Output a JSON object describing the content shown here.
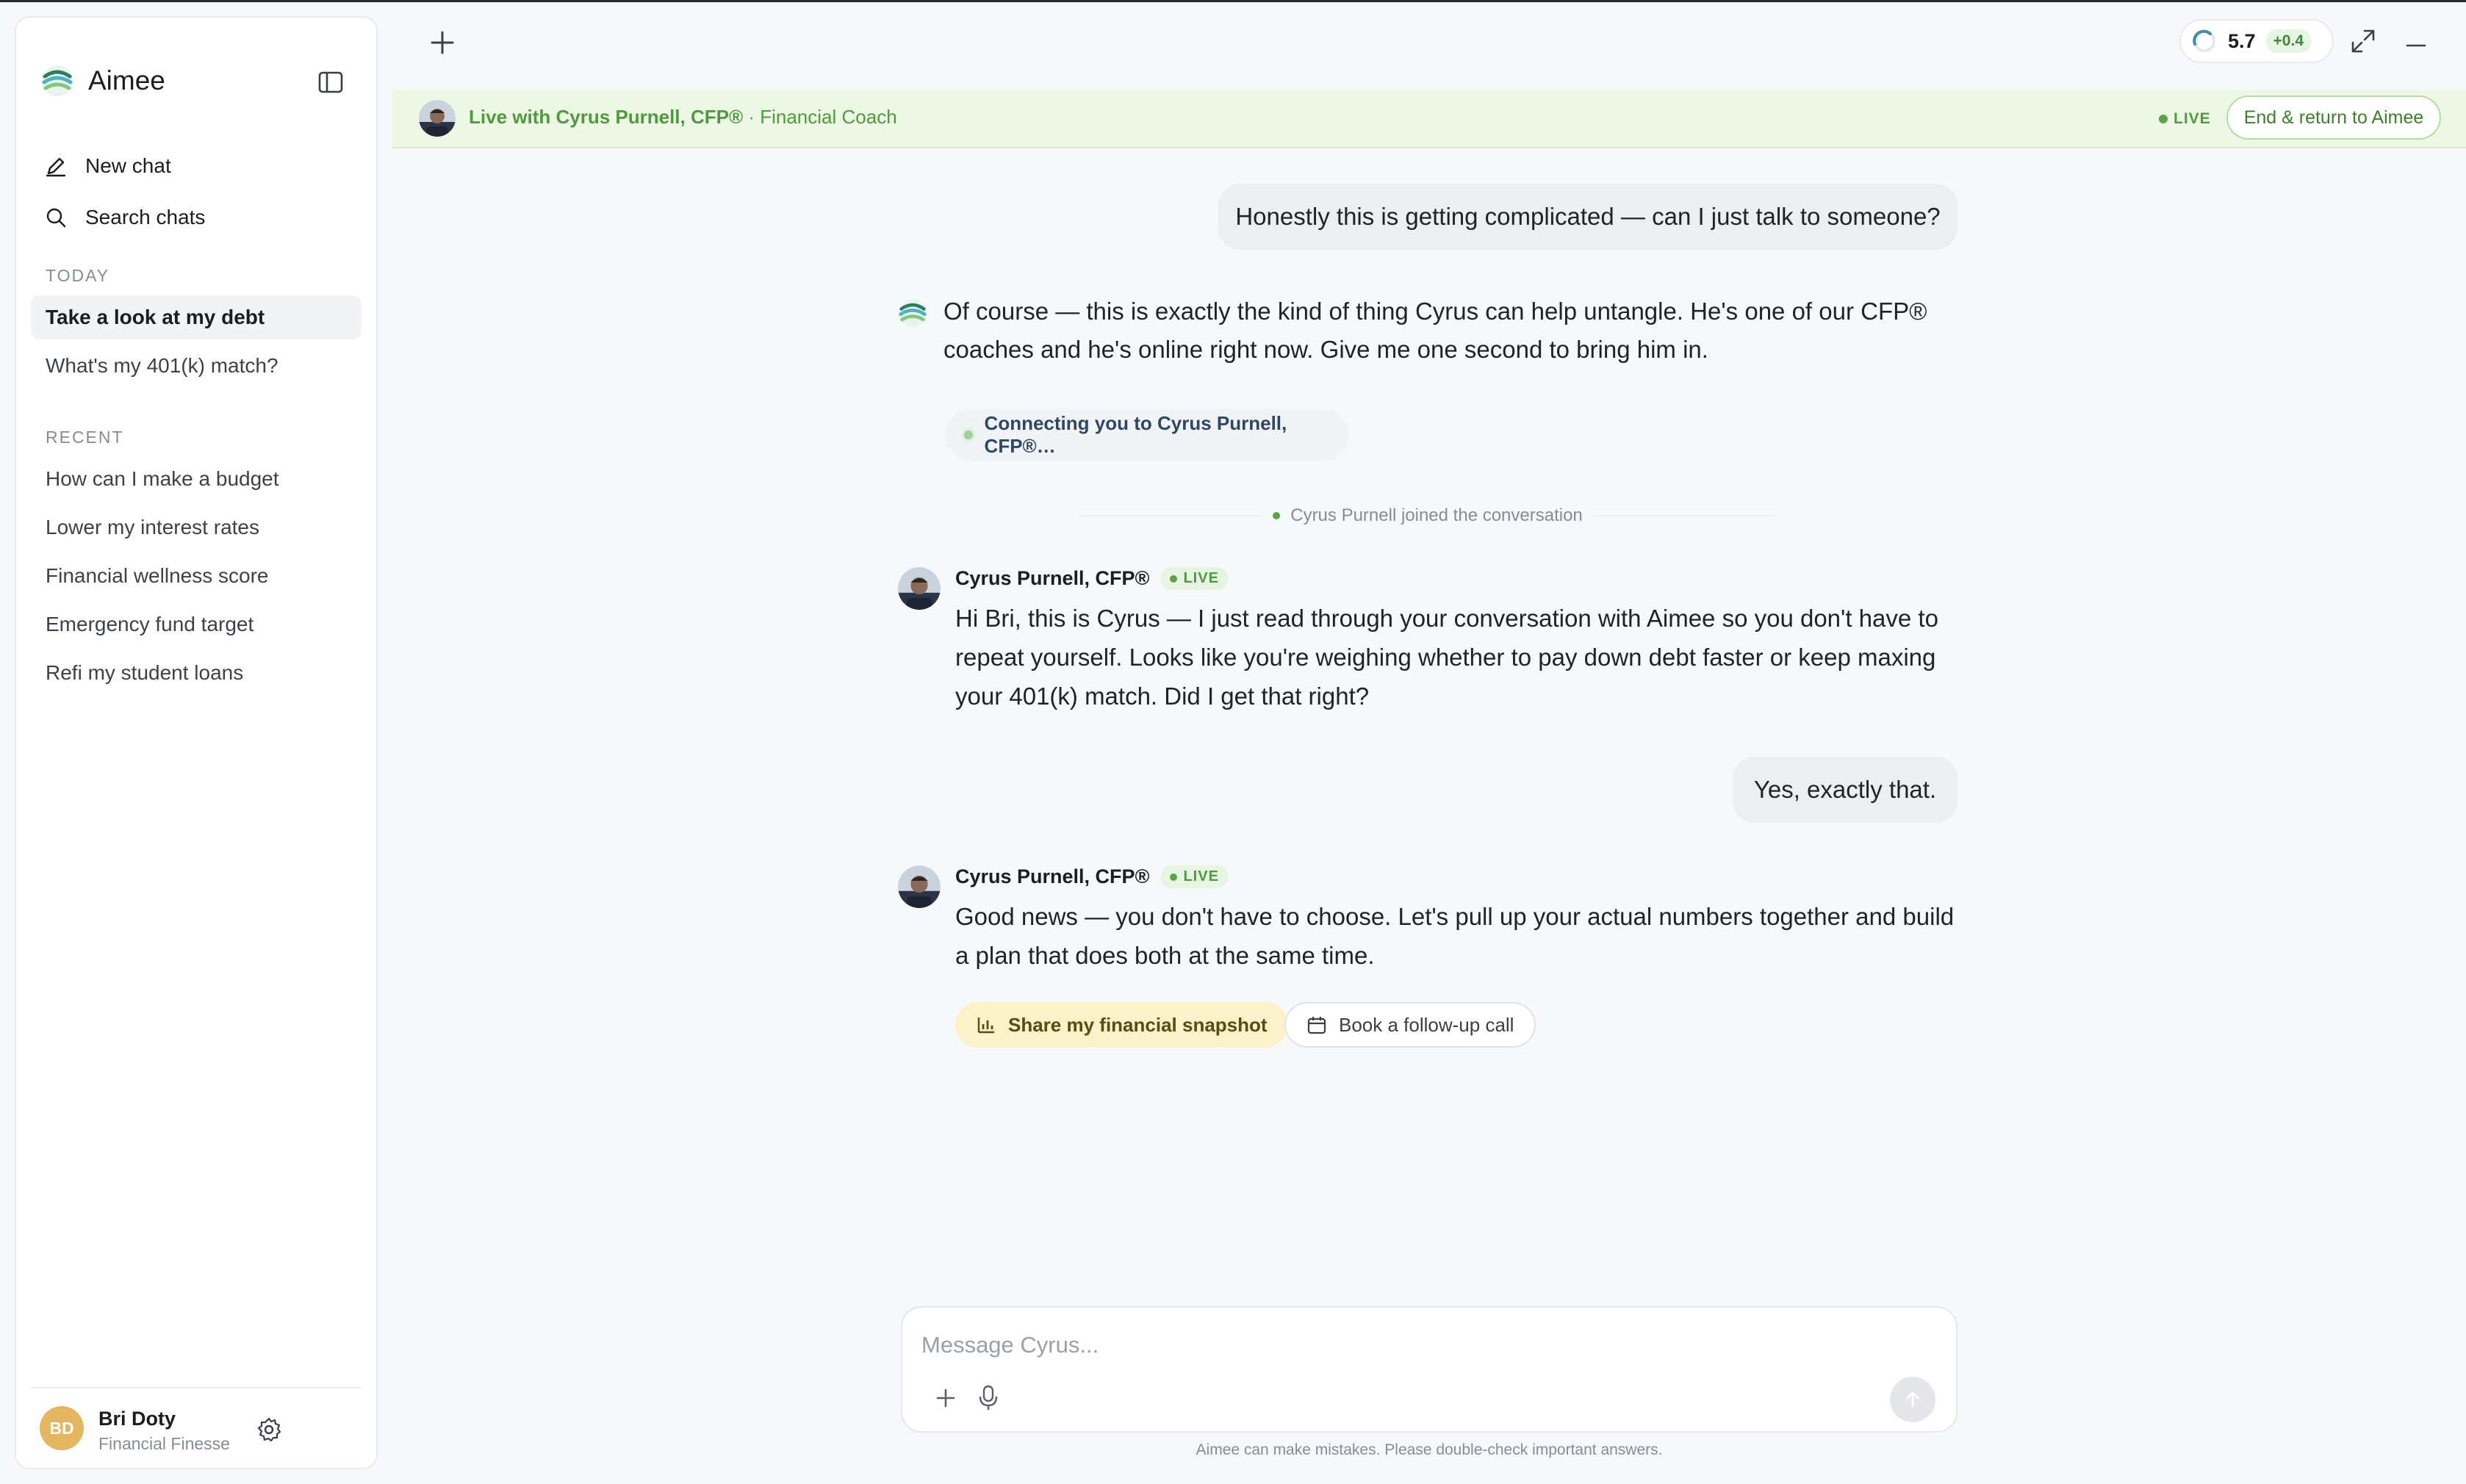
{
  "app": {
    "name": "Aimee"
  },
  "sidebar": {
    "nav": [
      {
        "label": "New chat",
        "icon": "pencil-icon"
      },
      {
        "label": "Search chats",
        "icon": "search-icon"
      }
    ],
    "today_label": "TODAY",
    "today": [
      {
        "label": "Take a look at my debt",
        "active": true
      },
      {
        "label": "What's my 401(k) match?",
        "active": false
      }
    ],
    "recent_label": "RECENT",
    "recent": [
      {
        "label": "How can I make a budget"
      },
      {
        "label": "Lower my interest rates"
      },
      {
        "label": "Financial wellness score"
      },
      {
        "label": "Emergency fund target"
      },
      {
        "label": "Refi my student loans"
      }
    ],
    "user": {
      "initials": "BD",
      "name": "Bri Doty",
      "subtitle": "Financial Finesse"
    }
  },
  "topbar": {
    "score": "5.7",
    "score_delta": "+0.4"
  },
  "banner": {
    "live_with": "Live with Cyrus Purnell, CFP®",
    "role": " · Financial Coach",
    "live_label": "LIVE",
    "end_button": "End & return to Aimee"
  },
  "messages": {
    "user_1": "Honestly this is getting complicated — can I just talk to someone?",
    "aimee_1": "Of course — this is exactly the kind of thing Cyrus can help untangle. He's one of our CFP® coaches and he's online right now. Give me one second to bring him in.",
    "connecting": "Connecting you to Cyrus Purnell, CFP®…",
    "joined": "Cyrus Purnell joined the conversation",
    "coach_name": "Cyrus Purnell, CFP®",
    "live_chip": "LIVE",
    "coach_1": "Hi Bri, this is Cyrus — I just read through your conversation with Aimee so you don't have to repeat yourself. Looks like you're weighing whether to pay down debt faster or keep maxing your 401(k) match. Did I get that right?",
    "user_2": "Yes, exactly that.",
    "coach_2": "Good news — you don't have to choose. Let's pull up your actual numbers together and build a plan that does both at the same time.",
    "action_primary": "Share my financial snapshot",
    "action_secondary": "Book a follow-up call"
  },
  "composer": {
    "placeholder": "Message Cyrus...",
    "disclaimer": "Aimee can make mistakes. Please double-check important answers."
  },
  "colors": {
    "live_green": "#4f9a3c",
    "banner_bg": "#ecf8e4",
    "highlight_yellow": "#fbf2c9",
    "avatar_gold": "#e4b660"
  }
}
